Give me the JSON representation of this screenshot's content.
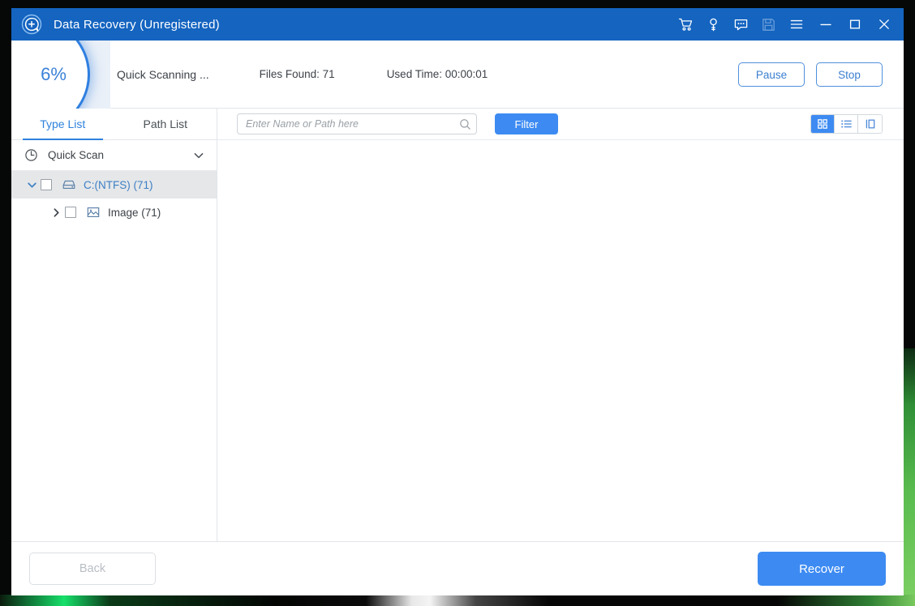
{
  "window": {
    "title": "Data Recovery (Unregistered)",
    "logo_icon": "magnifier-plus-bubble-icon"
  },
  "titlebar": {
    "buttons": [
      {
        "name": "cart-icon",
        "label": "Buy"
      },
      {
        "name": "key-icon",
        "label": "Register"
      },
      {
        "name": "chat-icon",
        "label": "Feedback"
      },
      {
        "name": "save-icon",
        "label": "Save"
      },
      {
        "name": "menu-icon",
        "label": "Menu"
      },
      {
        "name": "minimize-icon",
        "label": "Minimize"
      },
      {
        "name": "maximize-icon",
        "label": "Maximize"
      },
      {
        "name": "close-icon",
        "label": "Close"
      }
    ]
  },
  "scanbar": {
    "percent": "6%",
    "percent_value": 6,
    "status": "Quick Scanning ...",
    "files_found": "Files Found: 71",
    "used_time": "Used Time: 00:00:01",
    "pause_label": "Pause",
    "stop_label": "Stop",
    "accent": "#3b82d8"
  },
  "sidebar": {
    "tabs": [
      {
        "label": "Type List",
        "active": true
      },
      {
        "label": "Path List",
        "active": false
      }
    ],
    "scan_mode": "Quick Scan",
    "tree": [
      {
        "label": "C:(NTFS) (71)",
        "level": 0,
        "expanded": true,
        "selected": true,
        "icon": "drive-icon"
      },
      {
        "label": "Image (71)",
        "level": 1,
        "expanded": false,
        "selected": false,
        "icon": "image-icon"
      }
    ]
  },
  "toolbar": {
    "search_placeholder": "Enter Name or Path here",
    "search_value": "",
    "filter_label": "Filter",
    "view_modes": [
      {
        "name": "grid-view-icon",
        "active": true
      },
      {
        "name": "list-view-icon",
        "active": false
      },
      {
        "name": "split-view-icon",
        "active": false
      }
    ]
  },
  "footer": {
    "back_label": "Back",
    "back_disabled": true,
    "recover_label": "Recover"
  }
}
